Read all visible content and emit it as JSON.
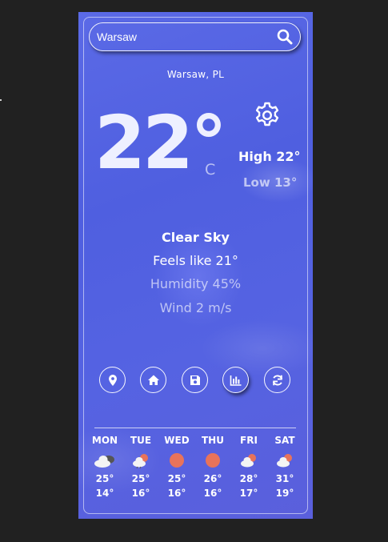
{
  "search": {
    "value": "Warsaw"
  },
  "location": "Warsaw, PL",
  "current": {
    "temp": "22°",
    "unit": "C",
    "high": "High 22°",
    "low": "Low 13°",
    "condition": "Clear Sky",
    "feels_like": "Feels like 21°",
    "humidity": "Humidity 45%",
    "wind": "Wind 2 m/s"
  },
  "actions": [
    {
      "icon": "location-pin-icon"
    },
    {
      "icon": "home-icon"
    },
    {
      "icon": "save-icon"
    },
    {
      "icon": "chart-icon",
      "active": true
    },
    {
      "icon": "refresh-icon"
    }
  ],
  "forecast": [
    {
      "day": "MON",
      "icon": "cloudy-icon",
      "high": "25°",
      "low": "14°"
    },
    {
      "day": "TUE",
      "icon": "partly-cloudy-icon",
      "high": "25°",
      "low": "16°"
    },
    {
      "day": "WED",
      "icon": "sun-icon",
      "high": "25°",
      "low": "16°"
    },
    {
      "day": "THU",
      "icon": "sun-icon",
      "high": "26°",
      "low": "16°"
    },
    {
      "day": "FRI",
      "icon": "partly-cloudy-icon",
      "high": "28°",
      "low": "17°"
    },
    {
      "day": "SAT",
      "icon": "partly-cloudy-icon",
      "high": "31°",
      "low": "19°"
    }
  ],
  "colors": {
    "background": "#212121",
    "card": "#5563e2",
    "sun": "#e8735a"
  }
}
